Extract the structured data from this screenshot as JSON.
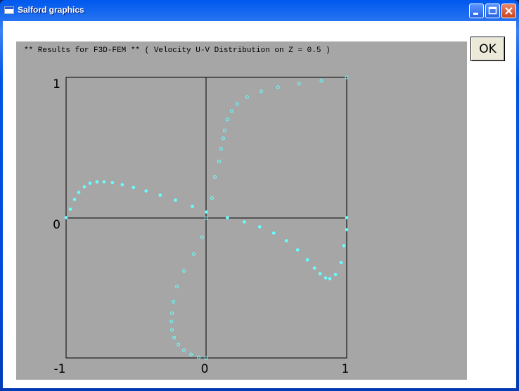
{
  "window": {
    "title": "Salford graphics",
    "controls": [
      "minimize",
      "maximize",
      "close"
    ]
  },
  "ok_button": {
    "label": "OK"
  },
  "plot": {
    "header": "** Results for F3D-FEM ** ( Velocity U-V Distribution on Z = 0.5 )",
    "background": "#a6a6a6",
    "marker_color": "#66ffff"
  },
  "chart_data": {
    "type": "scatter",
    "title": "** Results for F3D-FEM ** ( Velocity U-V Distribution on Z = 0.5 )",
    "xlim": [
      -1,
      1
    ],
    "ylim": [
      -1,
      1
    ],
    "x_ticks": [
      "-1",
      "0",
      "1"
    ],
    "y_ticks": [
      "1",
      "0"
    ],
    "grid": "crosshair at 0",
    "series": [
      {
        "marker": "filled",
        "points": [
          [
            -1.0,
            0.0
          ],
          [
            -0.97,
            0.06
          ],
          [
            -0.94,
            0.13
          ],
          [
            -0.91,
            0.18
          ],
          [
            -0.87,
            0.22
          ],
          [
            -0.83,
            0.245
          ],
          [
            -0.78,
            0.255
          ],
          [
            -0.73,
            0.255
          ],
          [
            -0.67,
            0.25
          ],
          [
            -0.6,
            0.235
          ],
          [
            -0.52,
            0.215
          ],
          [
            -0.43,
            0.19
          ],
          [
            -0.33,
            0.16
          ],
          [
            -0.22,
            0.125
          ],
          [
            -0.1,
            0.08
          ],
          [
            0.0,
            0.04
          ],
          [
            0.15,
            0.0
          ],
          [
            0.27,
            -0.03
          ],
          [
            0.38,
            -0.065
          ],
          [
            0.48,
            -0.11
          ],
          [
            0.57,
            -0.165
          ],
          [
            0.65,
            -0.23
          ],
          [
            0.72,
            -0.3
          ],
          [
            0.77,
            -0.36
          ],
          [
            0.81,
            -0.4
          ],
          [
            0.85,
            -0.43
          ],
          [
            0.88,
            -0.435
          ],
          [
            0.92,
            -0.405
          ],
          [
            0.96,
            -0.32
          ],
          [
            0.98,
            -0.2
          ],
          [
            1.0,
            -0.085
          ],
          [
            1.0,
            0.0
          ]
        ]
      },
      {
        "marker": "hollow",
        "points": [
          [
            0.0,
            -1.0
          ],
          [
            -0.055,
            -0.995
          ],
          [
            -0.11,
            -0.975
          ],
          [
            -0.16,
            -0.945
          ],
          [
            -0.2,
            -0.905
          ],
          [
            -0.23,
            -0.855
          ],
          [
            -0.245,
            -0.8
          ],
          [
            -0.25,
            -0.74
          ],
          [
            -0.245,
            -0.68
          ],
          [
            -0.235,
            -0.6
          ],
          [
            -0.21,
            -0.49
          ],
          [
            -0.16,
            -0.38
          ],
          [
            -0.09,
            -0.26
          ],
          [
            -0.03,
            -0.14
          ],
          [
            0.0,
            -0.005
          ],
          [
            0.04,
            0.14
          ],
          [
            0.06,
            0.29
          ],
          [
            0.09,
            0.4
          ],
          [
            0.105,
            0.49
          ],
          [
            0.12,
            0.565
          ],
          [
            0.13,
            0.62
          ],
          [
            0.15,
            0.7
          ],
          [
            0.18,
            0.76
          ],
          [
            0.22,
            0.81
          ],
          [
            0.29,
            0.86
          ],
          [
            0.39,
            0.9
          ],
          [
            0.51,
            0.93
          ],
          [
            0.66,
            0.955
          ],
          [
            0.82,
            0.975
          ],
          [
            1.0,
            1.0
          ]
        ]
      }
    ]
  }
}
